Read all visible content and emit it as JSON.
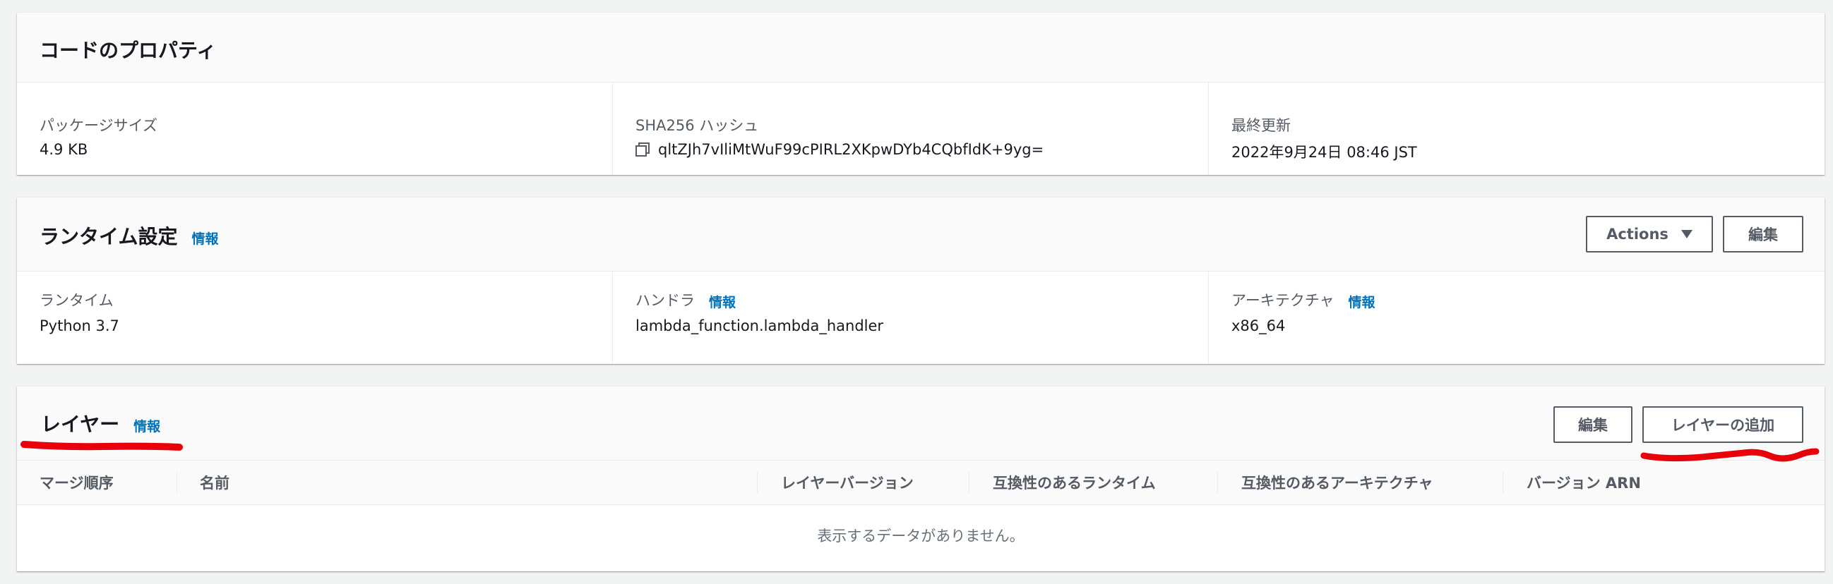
{
  "code_properties": {
    "title": "コードのプロパティ",
    "package_size_label": "パッケージサイズ",
    "package_size_value": "4.9 KB",
    "sha_label": "SHA256 ハッシュ",
    "sha_value": "qltZJh7vIliMtWuF99cPIRL2XKpwDYb4CQbfIdK+9yg=",
    "copy_icon": "copy-icon",
    "last_modified_label": "最終更新",
    "last_modified_value": "2022年9月24日 08:46 JST"
  },
  "runtime_settings": {
    "title": "ランタイム設定",
    "info": "情報",
    "actions_button": "Actions",
    "actions_icon": "caret-down-icon",
    "edit_button": "編集",
    "runtime_label": "ランタイム",
    "runtime_value": "Python 3.7",
    "handler_label": "ハンドラ",
    "handler_info": "情報",
    "handler_value": "lambda_function.lambda_handler",
    "architecture_label": "アーキテクチャ",
    "architecture_info": "情報",
    "architecture_value": "x86_64"
  },
  "layers": {
    "title": "レイヤー",
    "info": "情報",
    "edit_button": "編集",
    "add_layer_button": "レイヤーの追加",
    "columns": [
      "マージ順序",
      "名前",
      "レイヤーバージョン",
      "互換性のあるランタイム",
      "互換性のあるアーキテクチャ",
      "バージョン ARN"
    ],
    "empty_message": "表示するデータがありません。"
  },
  "colors": {
    "link": "#0073bb",
    "annotation": "#e8000b",
    "background": "#f2f3f3"
  }
}
